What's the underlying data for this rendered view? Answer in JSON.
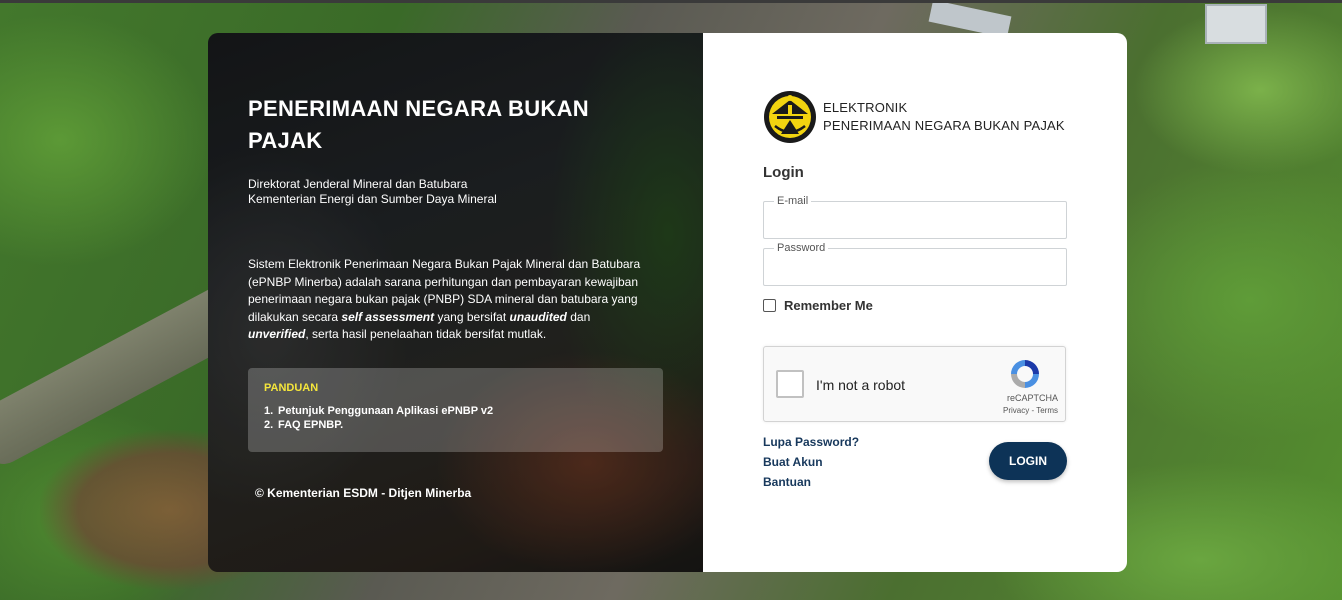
{
  "info_panel": {
    "title": "PENERIMAAN NEGARA BUKAN PAJAK",
    "org_line1": "Direktorat Jenderal Mineral dan Batubara",
    "org_line2": "Kementerian Energi dan Sumber Daya Mineral",
    "description_part1": "Sistem Elektronik Penerimaan Negara Bukan Pajak Mineral dan Batubara (ePNBP Minerba) adalah sarana perhitungan dan pembayaran kewajiban penerimaan negara bukan pajak (PNBP) SDA mineral dan batubara yang dilakukan secara",
    "description_em1": "self assessment",
    "description_part2": "yang bersifat",
    "description_em2": "unaudited",
    "description_part3": "dan",
    "description_em3": "unverified",
    "description_part4": ", serta hasil penelaahan tidak bersifat mutlak.",
    "guide": {
      "title": "PANDUAN",
      "items": [
        {
          "num": "1.",
          "label": "Petunjuk Penggunaan Aplikasi ePNBP v2"
        },
        {
          "num": "2.",
          "label": "FAQ EPNBP."
        }
      ]
    },
    "copyright": "© Kementerian ESDM - Ditjen Minerba"
  },
  "login": {
    "brand_line1": "ELEKTRONIK",
    "brand_line2": "PENERIMAAN NEGARA BUKAN PAJAK",
    "heading": "Login",
    "email_label": "E-mail",
    "email_value": "",
    "password_label": "Password",
    "password_value": "",
    "remember_label": "Remember Me",
    "remember_checked": false,
    "recaptcha": {
      "label": "I'm not a robot",
      "brand": "reCAPTCHA",
      "terms": "Privacy - Terms"
    },
    "links": {
      "forgot": "Lupa Password?",
      "register": "Buat Akun",
      "help": "Bantuan"
    },
    "button_label": "LOGIN"
  },
  "colors": {
    "button": "#0d3357",
    "link": "#17385c",
    "guide_title": "#f5e63b"
  }
}
